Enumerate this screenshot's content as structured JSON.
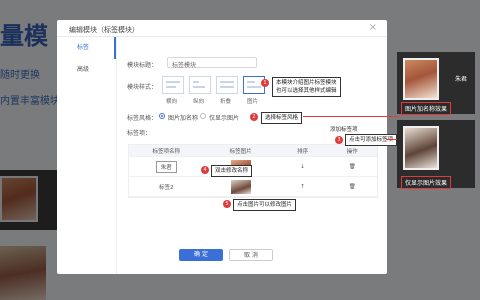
{
  "background": {
    "title": "量模",
    "sub1": "随时更换",
    "sub2": "内置丰富模块"
  },
  "modal": {
    "title": "编辑模块（标签模块）",
    "close": "×",
    "tabs": [
      {
        "label": "标签"
      },
      {
        "label": "高级"
      }
    ],
    "form": {
      "module_title_label": "模块标题：",
      "module_title_value": "标签模块",
      "module_style_label": "模块样式：",
      "styles": [
        {
          "label": "横向"
        },
        {
          "label": "纵向"
        },
        {
          "label": "折叠"
        },
        {
          "label": "图片"
        }
      ],
      "tag_style_label": "标签风格：",
      "tag_style_options": [
        {
          "label": "图片加名称"
        },
        {
          "label": "仅显示图片"
        }
      ],
      "tag_content_label": "标签项：",
      "add_tag_link": "添加标签项"
    },
    "table": {
      "headers": [
        "标签项名称",
        "标签图片",
        "排序",
        "操作"
      ],
      "rows": [
        {
          "name": "朱君",
          "sort": "↓"
        },
        {
          "name": "标签2",
          "sort": "↑"
        }
      ]
    },
    "buttons": {
      "ok": "确 定",
      "cancel": "取 消"
    }
  },
  "tips": {
    "t1_line1": "本模块介绍图片标签模块",
    "t1_line2": "也可以选择其他样式编辑",
    "t2": "选择标签风格",
    "t3": "点击可添加标签项",
    "t4": "双击修改名称",
    "t5": "点击图片可以修改图片",
    "dots": [
      "1",
      "2",
      "3",
      "4",
      "5"
    ]
  },
  "preview": {
    "card1_name": "朱君",
    "card1_caption": "图片加名称效果",
    "card2_caption": "仅显示图片效果"
  },
  "colors": {
    "accent": "#3a6fd8",
    "annotation": "#e23a3a"
  }
}
